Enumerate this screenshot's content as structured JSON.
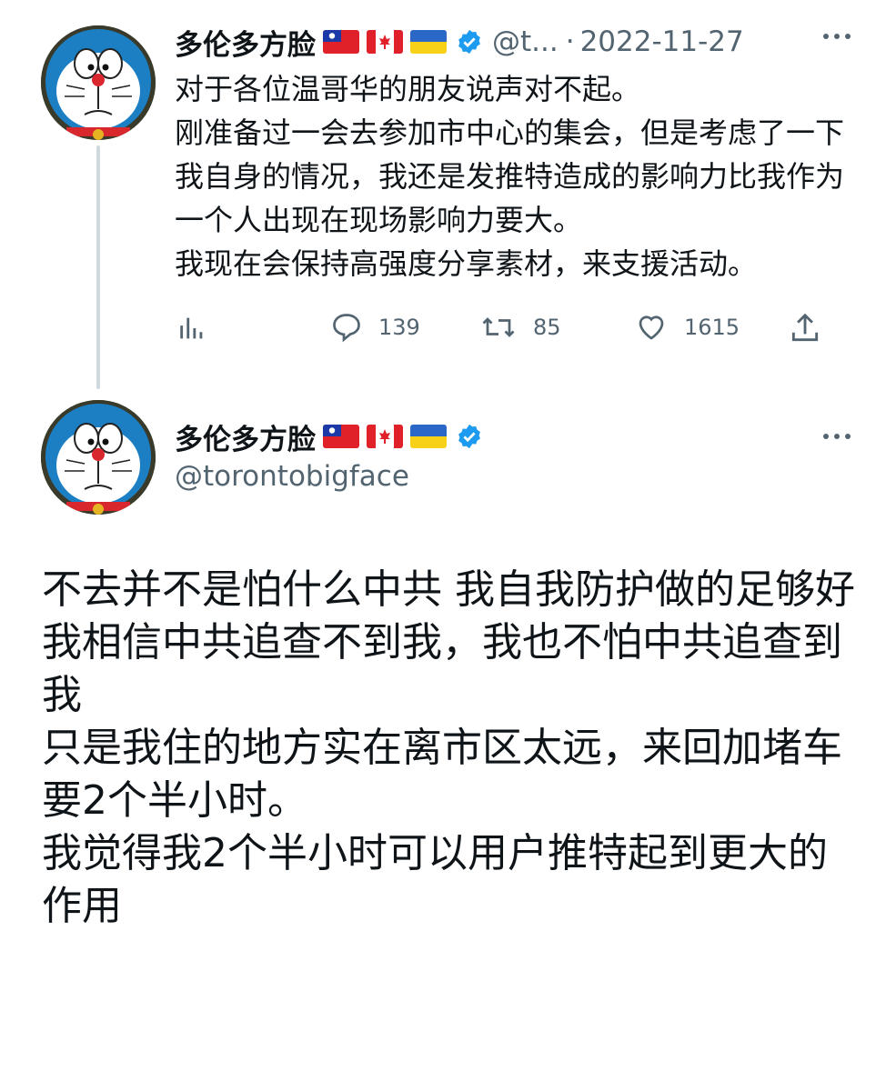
{
  "reply_tweet": {
    "display_name": "多伦多方脸",
    "flags": [
      "taiwan-flag",
      "canada-flag",
      "ukraine-flag"
    ],
    "verified_icon": "verified-badge-icon",
    "handle_truncated": "@t...",
    "separator": "·",
    "date": "2022-11-27",
    "more_icon": "more-options-icon",
    "text": "对于各位温哥华的朋友说声对不起。\n刚准备过一会去参加市中心的集会，但是考虑了一下我自身的情况，我还是发推特造成的影响力比我作为一个人出现在现场影响力要大。\n我现在会保持高强度分享素材，来支援活动。",
    "actions": {
      "analytics_icon": "analytics-icon",
      "reply_count": "139",
      "retweet_count": "85",
      "like_count": "1615",
      "share_icon": "share-icon"
    }
  },
  "main_tweet": {
    "display_name": "多伦多方脸",
    "flags": [
      "taiwan-flag",
      "canada-flag",
      "ukraine-flag"
    ],
    "verified_icon": "verified-badge-icon",
    "handle": "@torontobigface",
    "more_icon": "more-options-icon",
    "text": "不去并不是怕什么中共 我自我防护做的足够好\n我相信中共追查不到我，我也不怕中共追查到我\n只是我住的地方实在离市区太远，来回加堵车要2个半小时。\n我觉得我2个半小时可以用户推特起到更大的作用"
  },
  "colors": {
    "text": "#0f1419",
    "secondary": "#536471",
    "verified": "#1d9bf0",
    "thread_line": "#cfd9de"
  }
}
